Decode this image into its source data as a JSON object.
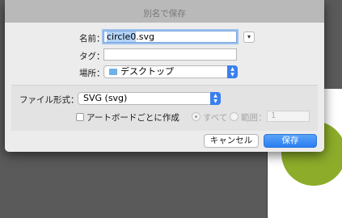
{
  "dialog": {
    "title": "別名で保存",
    "name_label": "名前：",
    "name_value_selected": "circle0",
    "name_value_ext": ".svg",
    "tags_label": "タグ：",
    "tags_value": "",
    "location_label": "場所：",
    "location_value": "デスクトップ",
    "format_label": "ファイル形式：",
    "format_value": "SVG (svg)",
    "artboard_label": "アートボードごとに作成",
    "all_label": "すべて",
    "range_label": "範囲：",
    "range_value": "1",
    "cancel_label": "キャンセル",
    "save_label": "保存"
  },
  "colors": {
    "accent": "#2a7ef2",
    "circle": "#8cac2a"
  }
}
